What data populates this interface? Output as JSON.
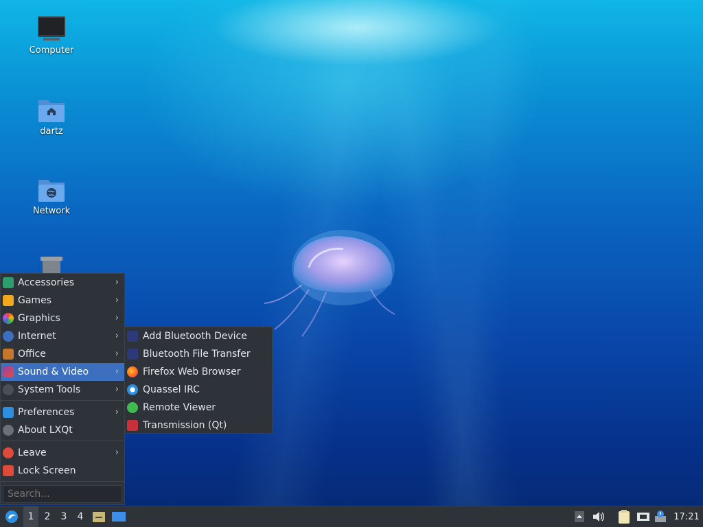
{
  "desktop": {
    "icons": [
      {
        "label": "Computer",
        "icon": "computer-icon"
      },
      {
        "label": "dartz",
        "icon": "home-folder-icon"
      },
      {
        "label": "Network",
        "icon": "network-folder-icon"
      },
      {
        "label": "Trash",
        "icon": "trash-icon"
      }
    ]
  },
  "menu": {
    "items": [
      {
        "label": "Accessories",
        "icon": "accessories-icon"
      },
      {
        "label": "Games",
        "icon": "games-icon"
      },
      {
        "label": "Graphics",
        "icon": "graphics-icon"
      },
      {
        "label": "Internet",
        "icon": "internet-icon"
      },
      {
        "label": "Office",
        "icon": "office-icon"
      },
      {
        "label": "Sound & Video",
        "icon": "sound-video-icon"
      },
      {
        "label": "System Tools",
        "icon": "system-tools-icon"
      },
      {
        "label": "Preferences",
        "icon": "preferences-icon"
      },
      {
        "label": "About LXQt",
        "icon": "info-icon"
      },
      {
        "label": "Leave",
        "icon": "power-icon"
      },
      {
        "label": "Lock Screen",
        "icon": "lock-icon"
      }
    ],
    "search_placeholder": "Search..."
  },
  "submenu": {
    "items": [
      {
        "label": "Add Bluetooth Device",
        "icon": "bluetooth-icon"
      },
      {
        "label": "Bluetooth File Transfer",
        "icon": "bluetooth-icon"
      },
      {
        "label": "Firefox Web Browser",
        "icon": "firefox-icon"
      },
      {
        "label": "Quassel IRC",
        "icon": "quassel-icon"
      },
      {
        "label": "Remote Viewer",
        "icon": "remote-viewer-icon"
      },
      {
        "label": "Transmission (Qt)",
        "icon": "transmission-icon"
      }
    ]
  },
  "taskbar": {
    "desktops": [
      "1",
      "2",
      "3",
      "4"
    ],
    "current_desktop": "1",
    "clock": "17:21"
  },
  "colors": {
    "panel_bg": "#2e3239",
    "highlight": "#3d6fbf"
  }
}
